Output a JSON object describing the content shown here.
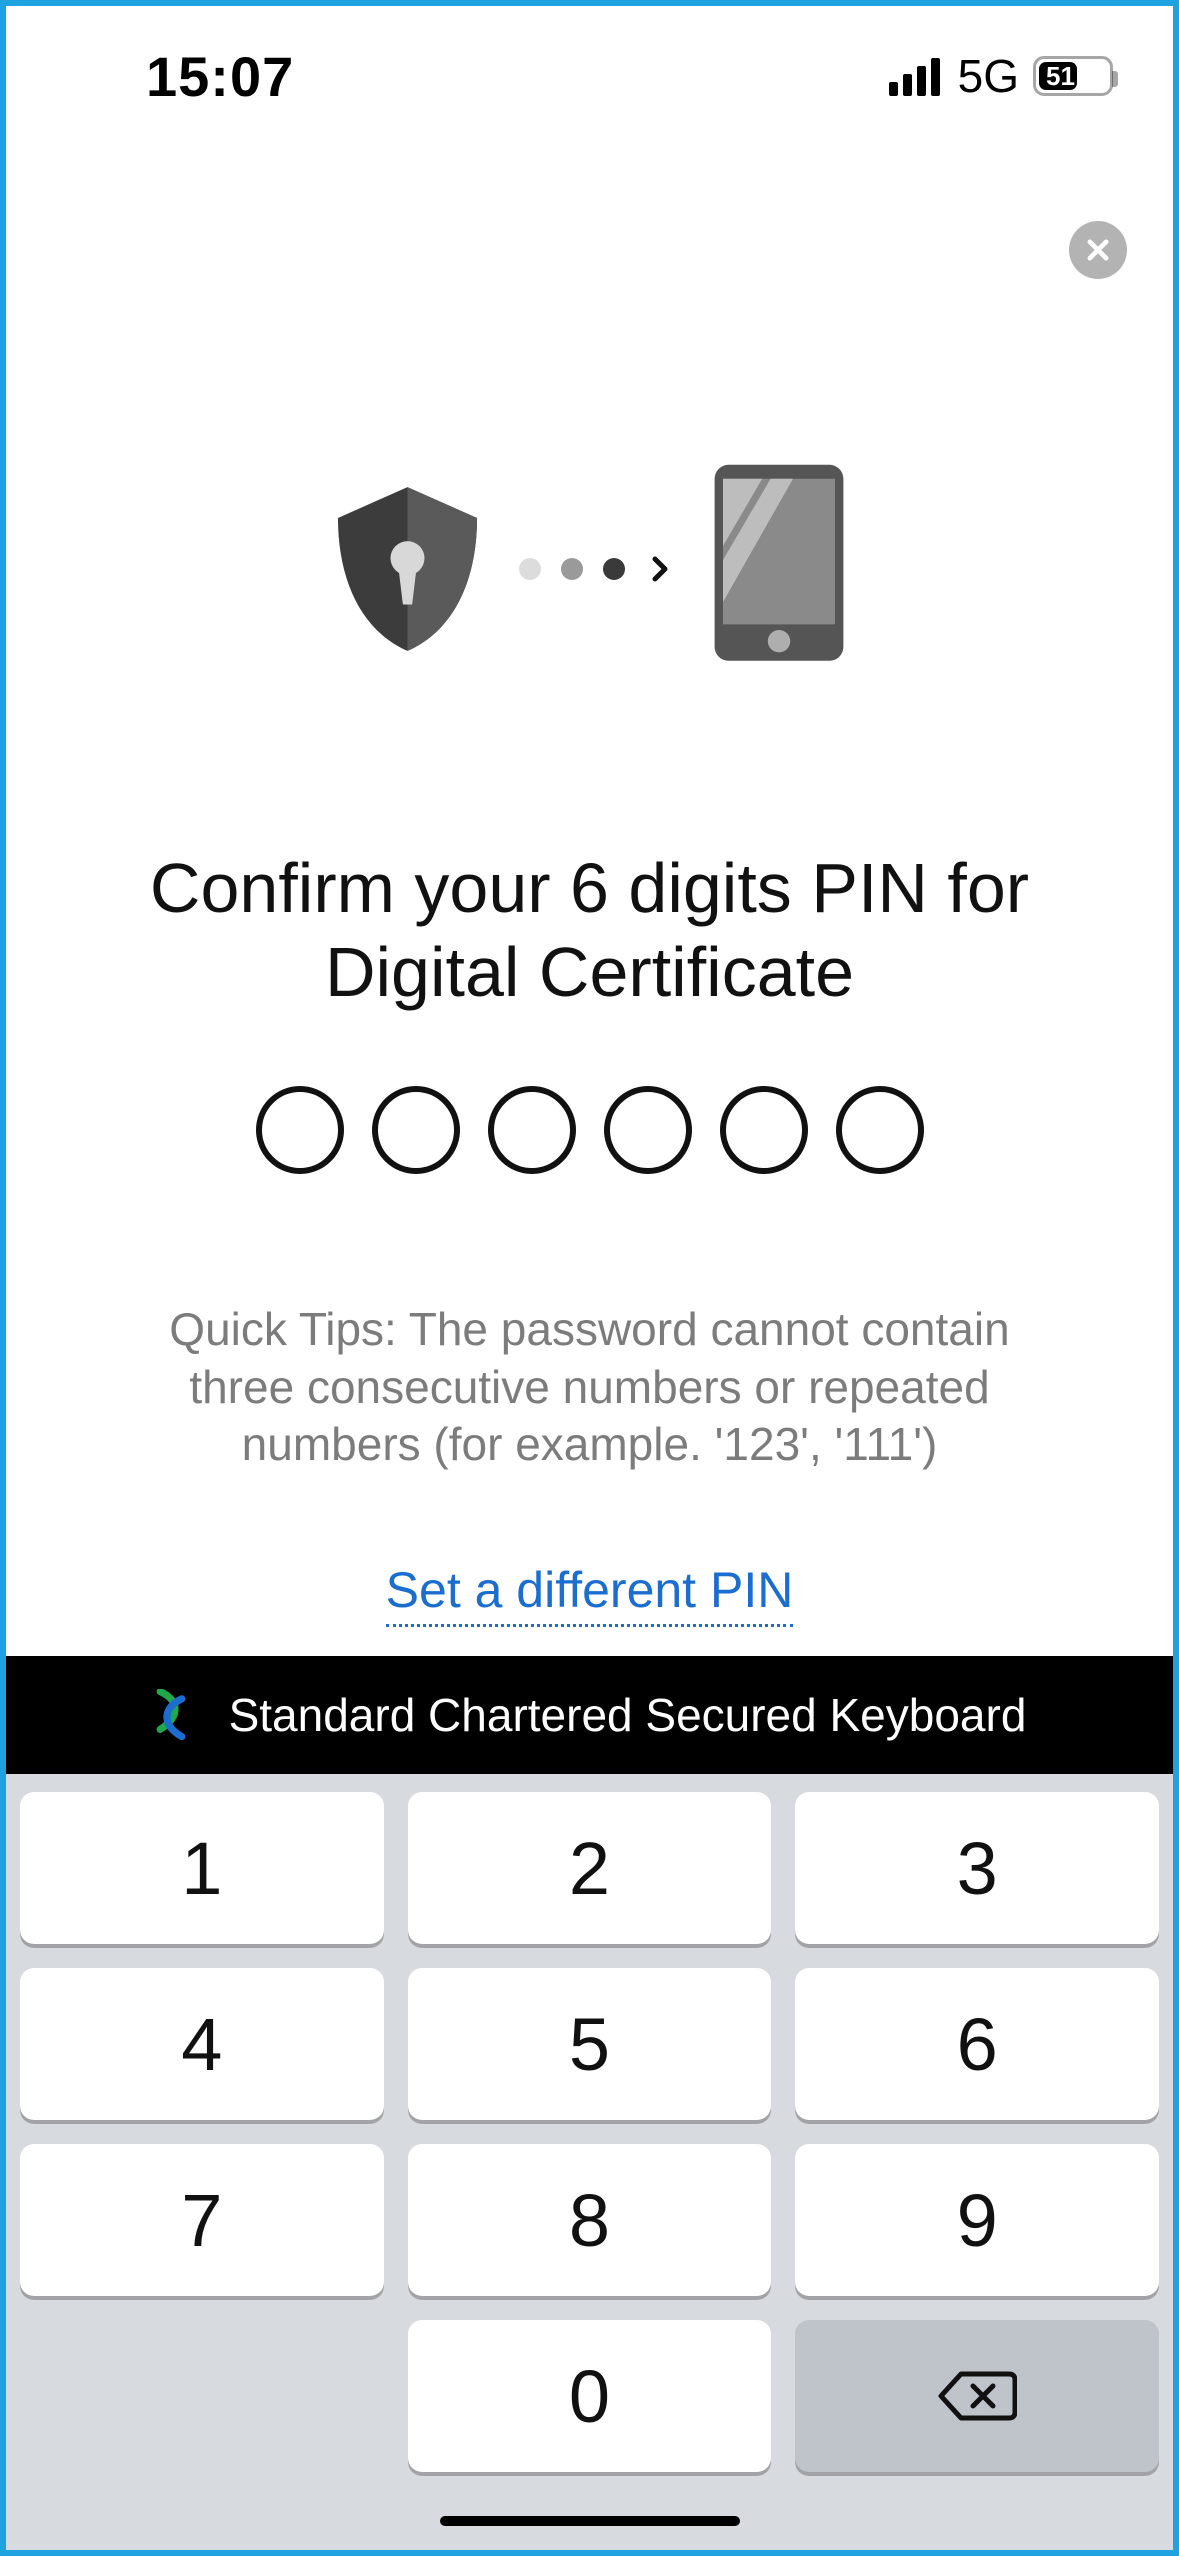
{
  "status": {
    "time": "15:07",
    "network": "5G",
    "battery_percent": "51"
  },
  "headline": "Confirm your 6 digits PIN for Digital Certificate",
  "pin": {
    "length": 6,
    "entered": 0
  },
  "tips": "Quick Tips: The password cannot contain three consecutive numbers or repeated numbers (for example. '123', '111')",
  "link": "Set a different PIN",
  "keyboard": {
    "header": "Standard Chartered Secured Keyboard",
    "keys": [
      "1",
      "2",
      "3",
      "4",
      "5",
      "6",
      "7",
      "8",
      "9",
      "",
      "0",
      "backspace"
    ]
  }
}
